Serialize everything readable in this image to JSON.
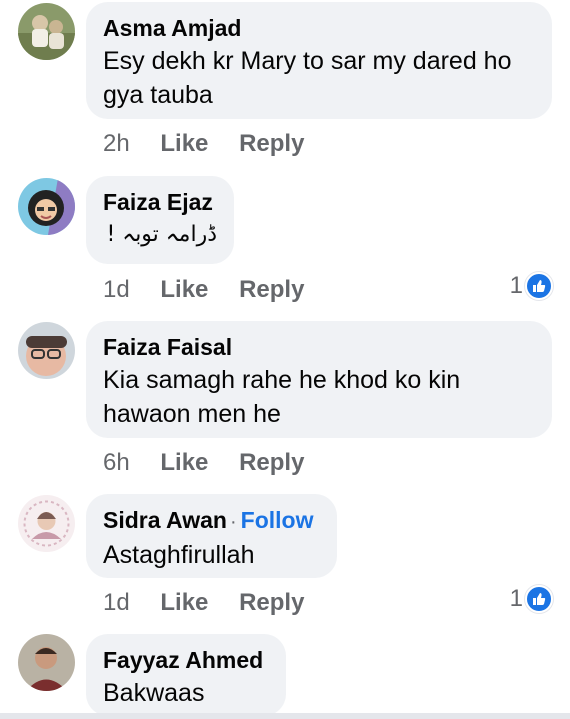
{
  "comments": [
    {
      "author": "Asma Amjad",
      "text": "Esy dekh kr Mary to sar my dared ho gya tauba",
      "time": "2h",
      "like_label": "Like",
      "reply_label": "Reply",
      "avatar_icon": "user-photo-icon"
    },
    {
      "author": "Faiza Ejaz",
      "text": "ڈرامہ توبہ !",
      "time": "1d",
      "like_label": "Like",
      "reply_label": "Reply",
      "reaction_count": "1",
      "avatar_icon": "user-photo-icon"
    },
    {
      "author": "Faiza Faisal",
      "text": "Kia samagh rahe he khod ko kin hawaon men he",
      "time": "6h",
      "like_label": "Like",
      "reply_label": "Reply",
      "avatar_icon": "user-photo-icon"
    },
    {
      "author": "Sidra Awan",
      "follow_label": "Follow",
      "text": "Astaghfirullah",
      "time": "1d",
      "like_label": "Like",
      "reply_label": "Reply",
      "reaction_count": "1",
      "avatar_icon": "user-photo-icon"
    },
    {
      "author": "Fayyaz Ahmed",
      "text": "Bakwaas",
      "avatar_icon": "user-photo-icon"
    }
  ],
  "colors": {
    "bubble": "#f0f2f5",
    "link": "#1b74e4",
    "secondary_text": "#65676b"
  }
}
